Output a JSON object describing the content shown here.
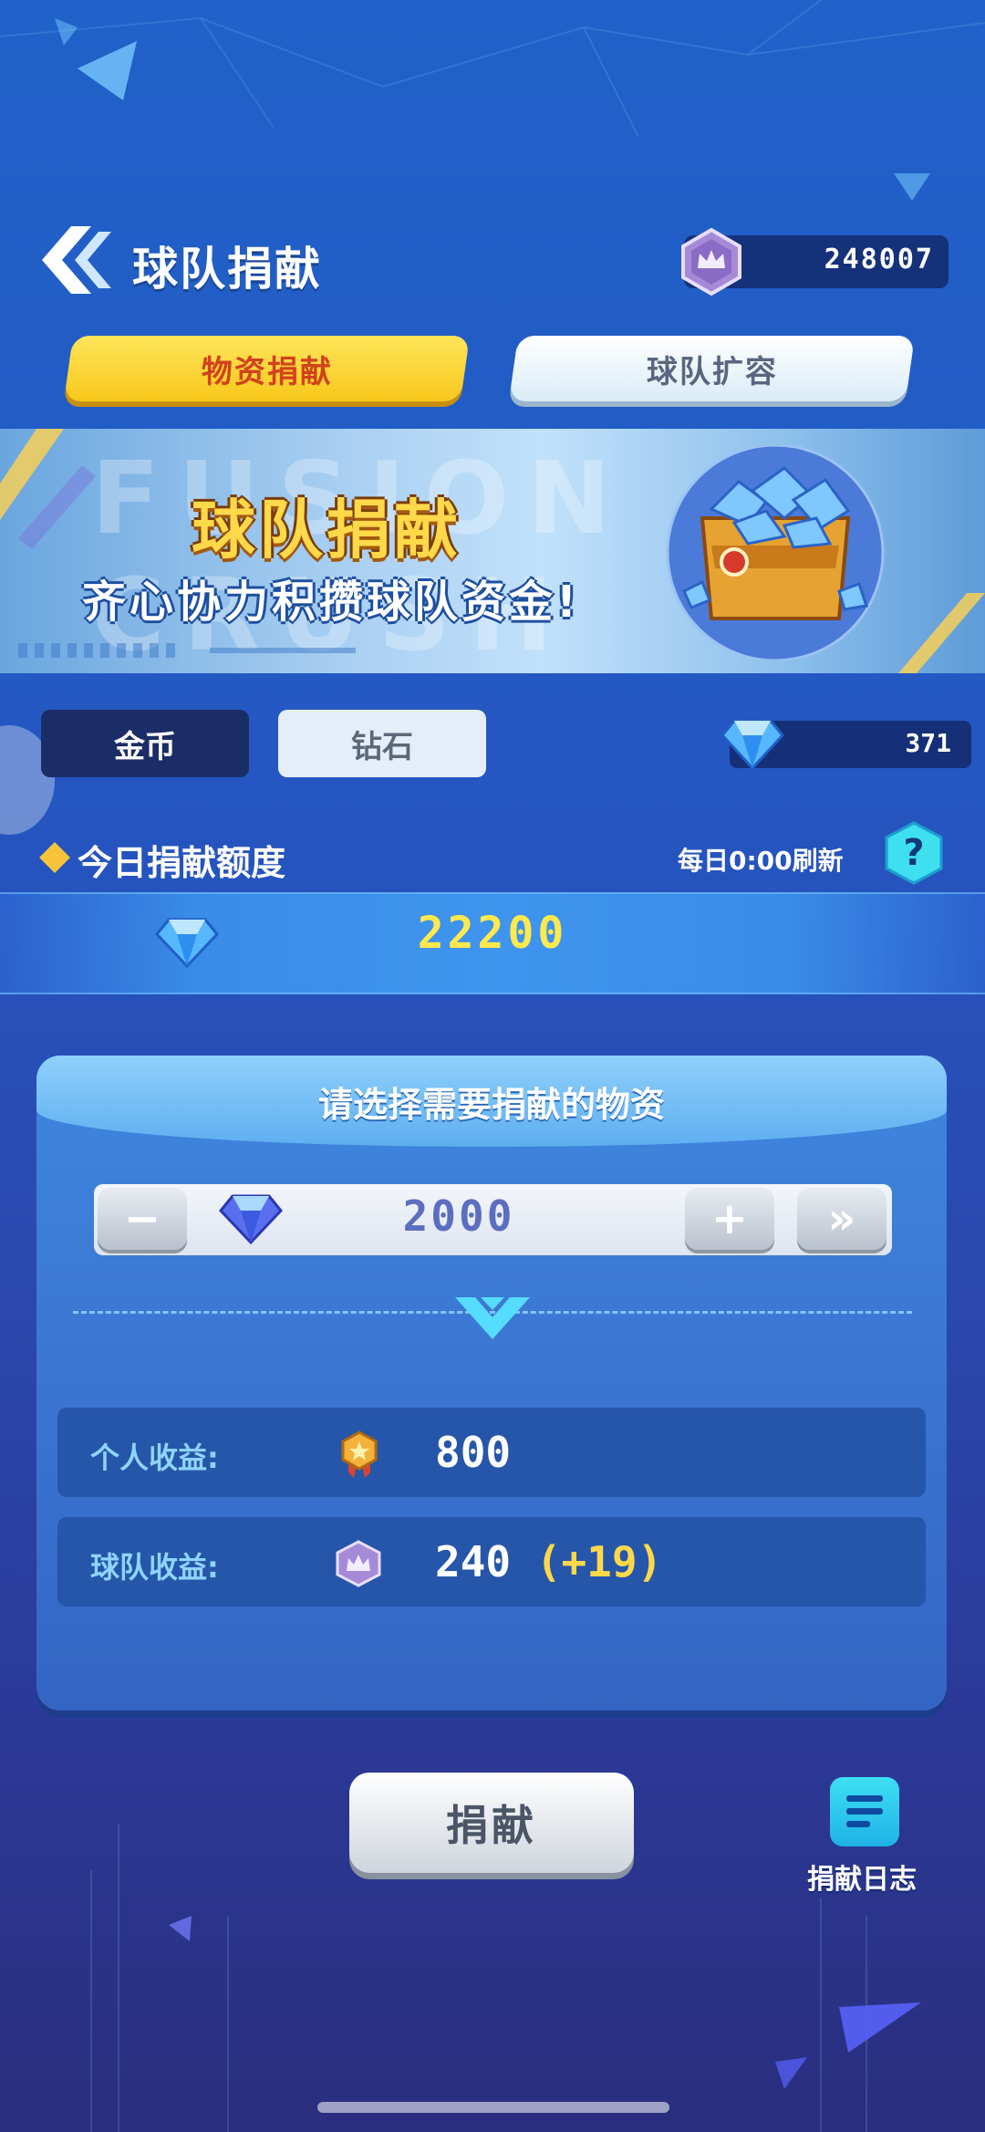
{
  "header": {
    "title": "球队捐献",
    "team_coin_balance": "248007"
  },
  "top_tabs": [
    {
      "label": "物资捐献",
      "active": true
    },
    {
      "label": "球队扩容",
      "active": false
    }
  ],
  "banner": {
    "background_text": "FUSION CRUSH",
    "title": "球队捐献",
    "subtitle": "齐心协力积攒球队资金!"
  },
  "currency_tabs": [
    {
      "label": "金币",
      "active": true
    },
    {
      "label": "钻石",
      "active": false
    }
  ],
  "diamond_balance": "371",
  "quota": {
    "label": "今日捐献额度",
    "refresh_text": "每日0:00刷新",
    "help": "?",
    "value": "22200"
  },
  "panel": {
    "title": "请选择需要捐献的物资",
    "stepper": {
      "minus": "−",
      "plus": "+",
      "max": "»",
      "value": "2000"
    },
    "rewards": [
      {
        "label": "个人收益:",
        "value": "800",
        "bonus": ""
      },
      {
        "label": "球队收益:",
        "value": "240",
        "bonus": "(+19)"
      }
    ]
  },
  "donate_button": "捐献",
  "log_button": "捐献日志",
  "colors": {
    "accent_yellow": "#f7c81b",
    "quota_yellow": "#ffe94d",
    "panel_blue": "#3b78d4"
  }
}
